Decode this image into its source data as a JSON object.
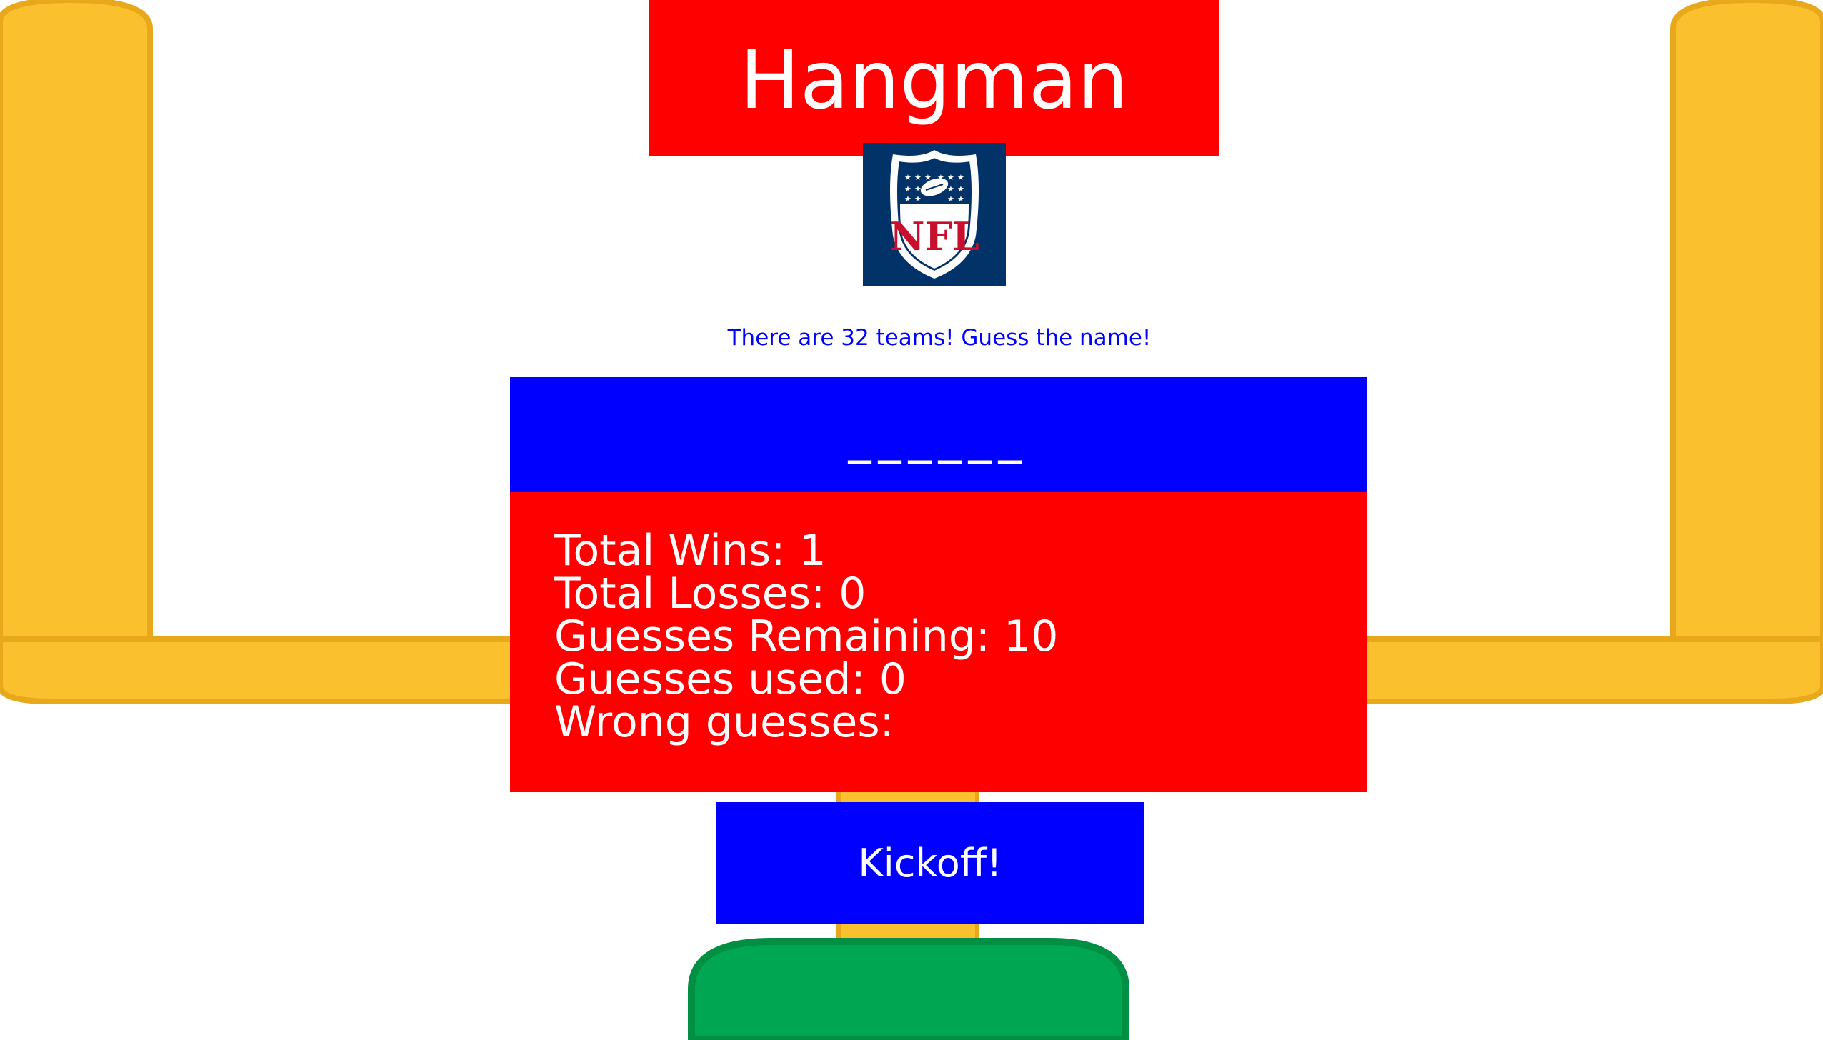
{
  "header": {
    "title": "Hangman"
  },
  "logo": {
    "icon": "nfl-shield-logo",
    "text": "NFL"
  },
  "instructions": "There are 32 teams! Guess the name!",
  "game": {
    "word_blanks": "______"
  },
  "stats": {
    "total_wins": "Total Wins: 1",
    "total_losses": "Total Losses: 0",
    "guesses_remaining": "Guesses Remaining: 10",
    "guesses_used": "Guesses used: 0",
    "wrong_guesses": "Wrong guesses: "
  },
  "actions": {
    "kickoff_label": "Kickoff!"
  },
  "colors": {
    "title_background": "#ff0000",
    "word_background": "#0000ff",
    "stats_background": "#ff0000",
    "button_background": "#0000ff",
    "instruction_text": "#0000ff",
    "goalpost": "#fbc02d",
    "goalpost_base": "#00a651",
    "logo_background": "#013369"
  }
}
